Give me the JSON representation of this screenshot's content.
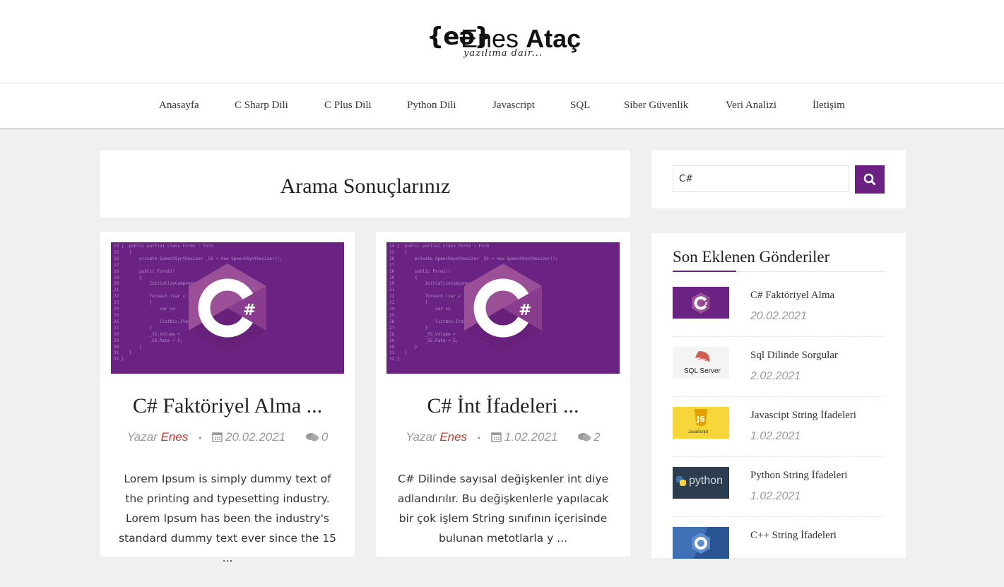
{
  "brand": {
    "logo_mark": "{eə}",
    "first_name": "Enes",
    "last_name": "Ataç",
    "tagline": "yazılıma dair..."
  },
  "nav": {
    "items": [
      "Anasayfa",
      "C Sharp Dili",
      "C Plus Dili",
      "Python Dili",
      "Javascript",
      "SQL",
      "Siber Güvenlik",
      "Veri Analizi",
      "İletişim"
    ]
  },
  "search_results": {
    "title": "Arama Sonuçlarınız"
  },
  "posts": [
    {
      "title": "C# Faktöriyel Alma ...",
      "author_prefix": "Yazar",
      "author": "Enes",
      "date": "20.02.2021",
      "comments": "0",
      "excerpt": "Lorem Ipsum is simply dummy text of the printing and typesetting industry. Lorem Ipsum has been the industry's standard dummy text ever since the 15 ...",
      "thumb_icon": "csharp-logo-icon"
    },
    {
      "title": "C# İnt İfadeleri ...",
      "author_prefix": "Yazar",
      "author": "Enes",
      "date": "1.02.2021",
      "comments": "2",
      "excerpt": "C# Dilinde sayısal değişkenler int diye adlandırılır. Bu değişkenlerle yapılacak bir çok işlem String sınıfının içerisinde bulunan metotlarla y ...",
      "thumb_icon": "csharp-logo-icon"
    }
  ],
  "sidebar": {
    "search": {
      "value": "C#",
      "button_icon": "search-icon"
    },
    "recent_title": "Son Eklenen Gönderiler",
    "recent": [
      {
        "title": "C# Faktöriyel Alma",
        "date": "20.02.2021",
        "thumb": "csharp"
      },
      {
        "title": "Sql Dilinde Sorgular",
        "date": "2.02.2021",
        "thumb": "sqlserver",
        "thumb_label": "SQL Server"
      },
      {
        "title": "Javascipt String İfadeleri",
        "date": "1.02.2021",
        "thumb": "javascript",
        "thumb_label": "JavaScript"
      },
      {
        "title": "Python String İfadeleri",
        "date": "1.02.2021",
        "thumb": "python",
        "thumb_label": "python"
      },
      {
        "title": "C++ String İfadeleri",
        "date": "",
        "thumb": "cpp"
      }
    ]
  },
  "colors": {
    "accent": "#6c2182",
    "author": "#c0392b",
    "csharp_purple": "#6a2383",
    "js_yellow": "#f7d63a",
    "python_dark": "#2b3d4f"
  }
}
